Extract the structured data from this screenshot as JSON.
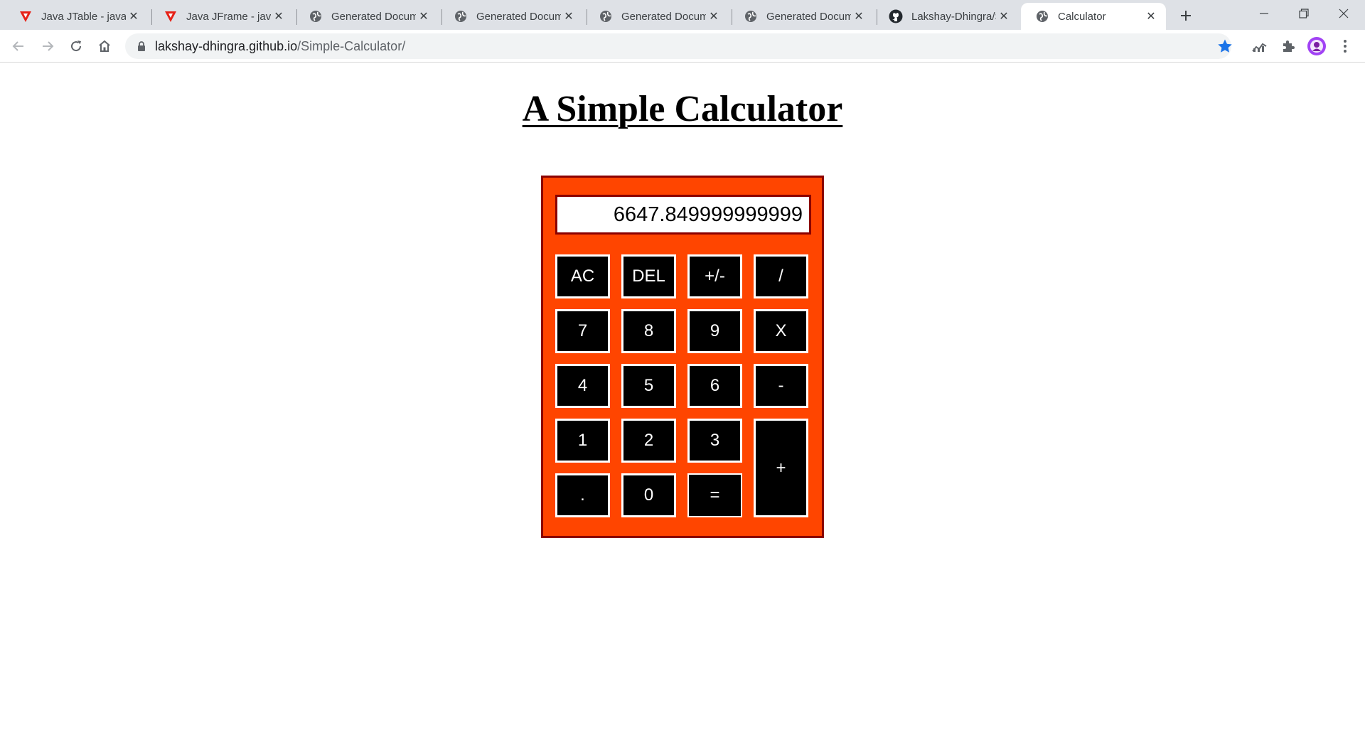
{
  "browser": {
    "tabs": [
      {
        "title": "Java JTable - javatpoint",
        "icon": "javatpoint-icon",
        "active": false
      },
      {
        "title": "Java JFrame - javatpoint",
        "icon": "javatpoint-icon",
        "active": false
      },
      {
        "title": "Generated Document",
        "icon": "globe-icon",
        "active": false
      },
      {
        "title": "Generated Document",
        "icon": "globe-icon",
        "active": false
      },
      {
        "title": "Generated Document",
        "icon": "globe-icon",
        "active": false
      },
      {
        "title": "Generated Document",
        "icon": "globe-icon",
        "active": false
      },
      {
        "title": "Lakshay-Dhingra/Simple-Calculator",
        "icon": "github-icon",
        "active": false
      },
      {
        "title": "Calculator",
        "icon": "globe-icon",
        "active": true
      }
    ],
    "url_host": "lakshay-dhingra.github.io",
    "url_path": "/Simple-Calculator/",
    "accent_color": "#1a73e8"
  },
  "page": {
    "title": "A Simple Calculator"
  },
  "calculator": {
    "display_value": "6647.849999999999",
    "body_color": "#ff4500",
    "border_color": "#8b0000",
    "keys": {
      "ac": "AC",
      "del": "DEL",
      "sign": "+/-",
      "divide": "/",
      "seven": "7",
      "eight": "8",
      "nine": "9",
      "multiply": "X",
      "four": "4",
      "five": "5",
      "six": "6",
      "minus": "-",
      "one": "1",
      "two": "2",
      "three": "3",
      "plus": "+",
      "dot": ".",
      "zero": "0",
      "equals": "="
    }
  }
}
